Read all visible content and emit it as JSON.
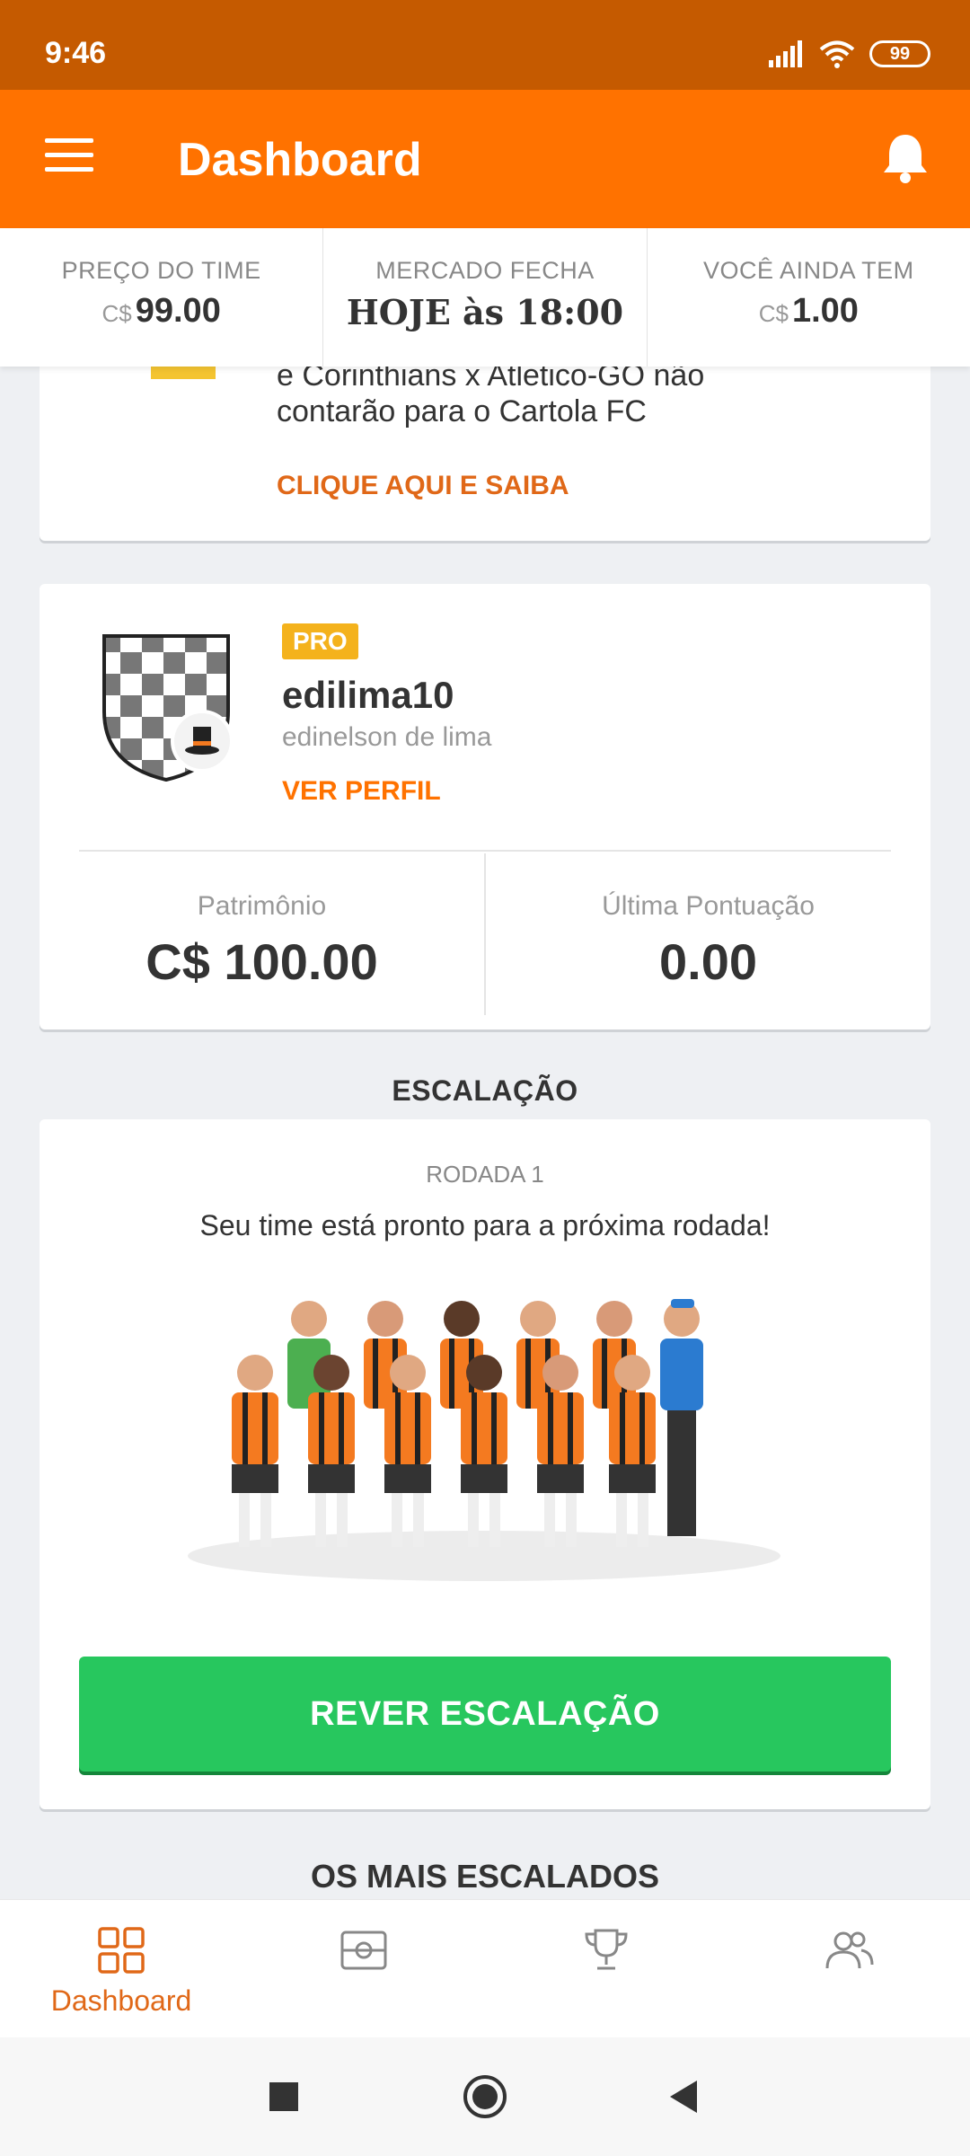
{
  "status_bar": {
    "time": "9:46",
    "battery": "99"
  },
  "app_bar": {
    "title": "Dashboard"
  },
  "stats": [
    {
      "label": "PREÇO DO TIME",
      "currency": "C$",
      "value": "99.00"
    },
    {
      "label": "MERCADO FECHA",
      "currency": "",
      "value": "HOJE às 18:00"
    },
    {
      "label": "VOCÊ AINDA TEM",
      "currency": "C$",
      "value": "1.00"
    }
  ],
  "news": {
    "line1": "e Corinthians x Atletico-GO não",
    "line2": "contarão para o Cartola FC",
    "link": "CLIQUE AQUI E SAIBA"
  },
  "profile": {
    "badge": "PRO",
    "username": "edilima10",
    "full_name": "edinelson de lima",
    "link": "VER PERFIL",
    "stats": [
      {
        "label": "Patrimônio",
        "value": "C$ 100.00"
      },
      {
        "label": "Última Pontuação",
        "value": "0.00"
      }
    ]
  },
  "lineup": {
    "section_title": "ESCALAÇÃO",
    "round": "RODADA 1",
    "message": "Seu time está pronto para a próxima rodada!",
    "button": "REVER ESCALAÇÃO"
  },
  "most_picked": {
    "section_title": "OS MAIS ESCALADOS"
  },
  "bottom_nav": {
    "items": [
      {
        "icon": "dashboard-grid-icon",
        "label": "Dashboard",
        "active": true
      },
      {
        "icon": "field-icon",
        "label": "",
        "active": false
      },
      {
        "icon": "trophy-icon",
        "label": "",
        "active": false
      },
      {
        "icon": "people-icon",
        "label": "",
        "active": false
      }
    ]
  },
  "colors": {
    "accent": "#ff7200",
    "status_bar": "#c55a00",
    "link_orange": "#e06818",
    "button_green": "#27c75e",
    "pro_badge": "#f4b21c",
    "jersey_orange": "#f47a20"
  }
}
